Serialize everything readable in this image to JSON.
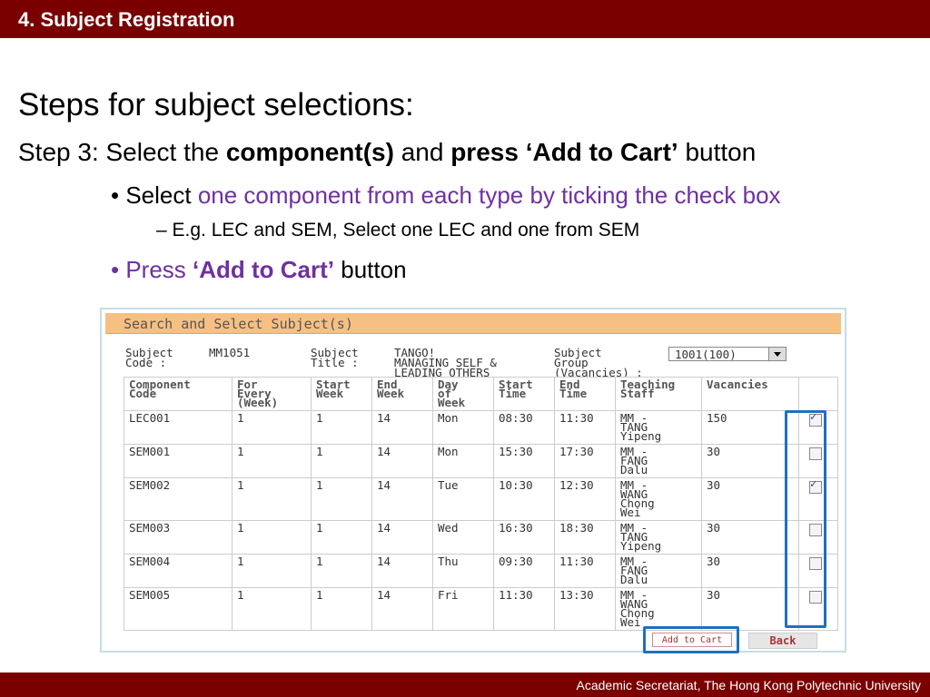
{
  "header": {
    "title": "4. Subject Registration"
  },
  "slide": {
    "heading": "Steps for subject selections:",
    "step": {
      "prefix": "Step 3: Select the ",
      "b1": "component(s)",
      "mid": " and ",
      "b2": "press ‘Add to Cart’",
      "suffix": " button"
    },
    "bullet1": {
      "a": "Select ",
      "b": "one component from each type by ticking the check box"
    },
    "sub1": "E.g. LEC and SEM, Select one LEC and one from SEM",
    "bullet2": {
      "a": "Press ",
      "b": "‘Add to Cart’",
      "c": " button"
    }
  },
  "panel": {
    "title": "Search and Select Subject(s)",
    "subject_code_label": [
      "Subject",
      "Code :"
    ],
    "subject_code": "MM1051",
    "subject_title_label": [
      "Subject",
      "Title :"
    ],
    "subject_title": [
      "TANGO!",
      "MANAGING SELF &",
      "LEADING OTHERS"
    ],
    "subject_group_label": [
      "Subject",
      "Group",
      "(Vacancies) :"
    ],
    "subject_group_value": "1001(100)",
    "columns": [
      [
        "Component",
        "Code"
      ],
      [
        "For",
        "Every",
        "(Week)"
      ],
      [
        "Start",
        "Week"
      ],
      [
        "End",
        "Week"
      ],
      [
        "Day",
        "of",
        "Week"
      ],
      [
        "Start",
        "Time"
      ],
      [
        "End",
        "Time"
      ],
      [
        "Teaching",
        "Staff"
      ],
      [
        "Vacancies"
      ],
      [
        ""
      ]
    ],
    "rows": [
      {
        "code": "LEC001",
        "every": "1",
        "sw": "1",
        "ew": "14",
        "day": "Mon",
        "st": "08:30",
        "et": "11:30",
        "staff": [
          "MM -",
          "TANG",
          "Yipeng"
        ],
        "vac": "150",
        "checked": true
      },
      {
        "code": "SEM001",
        "every": "1",
        "sw": "1",
        "ew": "14",
        "day": "Mon",
        "st": "15:30",
        "et": "17:30",
        "staff": [
          "MM -",
          "FANG",
          "Dalu"
        ],
        "vac": "30",
        "checked": false
      },
      {
        "code": "SEM002",
        "every": "1",
        "sw": "1",
        "ew": "14",
        "day": "Tue",
        "st": "10:30",
        "et": "12:30",
        "staff": [
          "MM -",
          "WANG",
          "Chong",
          "Wei"
        ],
        "vac": "30",
        "checked": true
      },
      {
        "code": "SEM003",
        "every": "1",
        "sw": "1",
        "ew": "14",
        "day": "Wed",
        "st": "16:30",
        "et": "18:30",
        "staff": [
          "MM -",
          "TANG",
          "Yipeng"
        ],
        "vac": "30",
        "checked": false
      },
      {
        "code": "SEM004",
        "every": "1",
        "sw": "1",
        "ew": "14",
        "day": "Thu",
        "st": "09:30",
        "et": "11:30",
        "staff": [
          "MM -",
          "FANG",
          "Dalu"
        ],
        "vac": "30",
        "checked": false
      },
      {
        "code": "SEM005",
        "every": "1",
        "sw": "1",
        "ew": "14",
        "day": "Fri",
        "st": "11:30",
        "et": "13:30",
        "staff": [
          "MM -",
          "WANG",
          "Chong",
          "Wei"
        ],
        "vac": "30",
        "checked": false
      }
    ],
    "add_to_cart_label": "Add to Cart",
    "back_label": "Back"
  },
  "footer": {
    "text": "Academic Secretariat, The Hong Kong Polytechnic University"
  },
  "colors": {
    "brand": "#7a0000",
    "accent_purple": "#7030a0",
    "highlight_blue": "#1f6fbf",
    "panel_header": "#f6c083"
  }
}
